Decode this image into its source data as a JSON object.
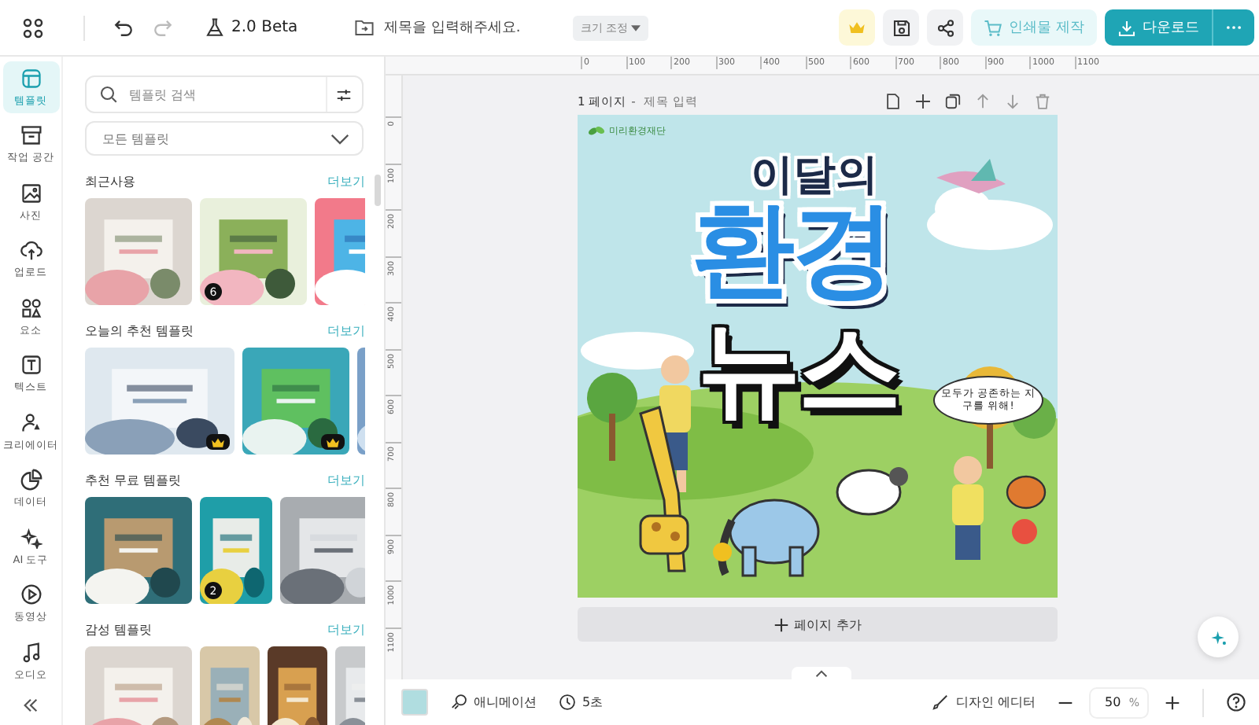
{
  "top_bar": {
    "version": "2.0 Beta",
    "title_placeholder": "제목을 입력해주세요.",
    "resize_button": "크기 조정",
    "print_button": "인쇄물 제작",
    "download_button": "다운로드"
  },
  "sidebar": {
    "items": [
      {
        "label": "템플릿",
        "selected": true
      },
      {
        "label": "작업 공간",
        "selected": false
      },
      {
        "label": "사진",
        "selected": false
      },
      {
        "label": "업로드",
        "selected": false
      },
      {
        "label": "요소",
        "selected": false
      },
      {
        "label": "텍스트",
        "selected": false
      },
      {
        "label": "크리에이터",
        "selected": false
      },
      {
        "label": "데이터",
        "selected": false
      },
      {
        "label": "AI 도구",
        "selected": false
      },
      {
        "label": "동영상",
        "selected": false
      },
      {
        "label": "오디오",
        "selected": false
      }
    ]
  },
  "panel": {
    "search_placeholder": "템플릿 검색",
    "filter": "모든 템플릿",
    "sections": [
      {
        "title": "최근사용",
        "more": "더보기",
        "thumbnails": [
          {
            "kind": "picture",
            "premium": false
          },
          {
            "kind": "picture",
            "badge": "6",
            "premium": false
          },
          {
            "kind": "picture"
          }
        ]
      },
      {
        "title": "오늘의 추천 템플릿",
        "more": "더보기",
        "thumbnails": [
          {
            "kind": "picture",
            "premium": true
          },
          {
            "kind": "picture",
            "premium": true
          },
          {
            "kind": "picture"
          }
        ]
      },
      {
        "title": "추천 무료 템플릿",
        "more": "더보기",
        "thumbnails": [
          {
            "kind": "picture",
            "premium": false
          },
          {
            "kind": "picture",
            "badge": "2",
            "premium": false
          },
          {
            "kind": "picture"
          }
        ]
      },
      {
        "title": "감성 템플릿",
        "more": "더보기",
        "thumbnails": [
          {
            "kind": "picture"
          },
          {
            "kind": "picture"
          },
          {
            "kind": "picture"
          },
          {
            "kind": "picture"
          }
        ]
      }
    ]
  },
  "ruler": {
    "marks": [
      "0",
      "100",
      "200",
      "300",
      "400",
      "500",
      "600",
      "700",
      "800",
      "900",
      "1000",
      "1100"
    ]
  },
  "side_ruler": {
    "marks": [
      "0",
      "100",
      "200",
      "300",
      "400",
      "500",
      "600",
      "700",
      "800",
      "900",
      "1000",
      "1100"
    ]
  },
  "page": {
    "label": "1 페이지",
    "separator": "-",
    "title_placeholder": "제목 입력"
  },
  "poster": {
    "logo": "미리환경재단",
    "headline_top": "이달의",
    "headline_main": "환경",
    "headline_bottom": "뉴스",
    "bubble": "모두가 공존하는 지구를 위해!"
  },
  "add_page_button": "페이지 추가",
  "bottom_bar": {
    "swatch": {
      "color": "#b0dde0"
    },
    "animation": "애니메이션",
    "duration": "5초",
    "design_editor": "디자인 에디터",
    "zoom": "50",
    "zoom_unit": "%"
  }
}
